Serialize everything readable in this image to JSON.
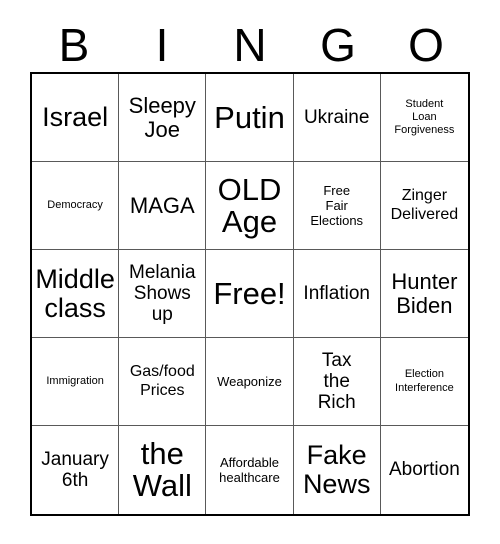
{
  "card": {
    "header_letters": [
      "B",
      "I",
      "N",
      "G",
      "O"
    ],
    "columns": 5,
    "rows": 5,
    "colors": {
      "background": "#ffffff",
      "text": "#000000",
      "outer_border": "#000000",
      "inner_grid_line": "#595959"
    },
    "cells": [
      {
        "text": "Israel",
        "size": "xl"
      },
      {
        "text": "Sleepy\nJoe",
        "size": "lg"
      },
      {
        "text": "Putin",
        "size": "xxl"
      },
      {
        "text": "Ukraine",
        "size": "md"
      },
      {
        "text": "Student\nLoan\nForgiveness",
        "size": "xxs"
      },
      {
        "text": "Democracy",
        "size": "xxs"
      },
      {
        "text": "MAGA",
        "size": "lg"
      },
      {
        "text": "OLD\nAge",
        "size": "xxl"
      },
      {
        "text": "Free\nFair\nElections",
        "size": "xs"
      },
      {
        "text": "Zinger\nDelivered",
        "size": "sm"
      },
      {
        "text": "Middle\nclass",
        "size": "xl"
      },
      {
        "text": "Melania\nShows\nup",
        "size": "md"
      },
      {
        "text": "Free!",
        "size": "xxl"
      },
      {
        "text": "Inflation",
        "size": "md"
      },
      {
        "text": "Hunter\nBiden",
        "size": "lg"
      },
      {
        "text": "Immigration",
        "size": "xxs"
      },
      {
        "text": "Gas/food\nPrices",
        "size": "sm"
      },
      {
        "text": "Weaponize",
        "size": "xs"
      },
      {
        "text": "Tax\nthe\nRich",
        "size": "md"
      },
      {
        "text": "Election\nInterference",
        "size": "xxs"
      },
      {
        "text": "January\n6th",
        "size": "md"
      },
      {
        "text": "the\nWall",
        "size": "xxl"
      },
      {
        "text": "Affordable\nhealthcare",
        "size": "xs"
      },
      {
        "text": "Fake\nNews",
        "size": "xl"
      },
      {
        "text": "Abortion",
        "size": "md"
      }
    ]
  }
}
